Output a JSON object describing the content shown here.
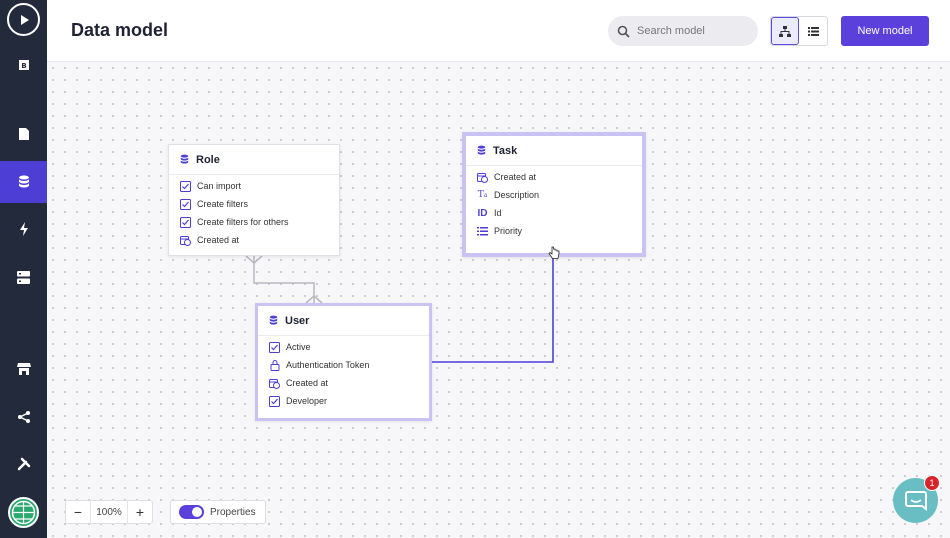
{
  "sidebar": {
    "items": [
      {
        "name": "book-icon"
      },
      {
        "name": "pages-icon"
      },
      {
        "name": "database-icon"
      },
      {
        "name": "lightning-icon"
      },
      {
        "name": "server-icon"
      },
      {
        "name": "store-icon"
      },
      {
        "name": "share-icon"
      },
      {
        "name": "tools-icon"
      }
    ]
  },
  "header": {
    "title": "Data model",
    "search_placeholder": "Search model",
    "new_button": "New model"
  },
  "models": {
    "role": {
      "title": "Role",
      "fields": [
        {
          "label": "Can import",
          "icon": "checkbox-icon"
        },
        {
          "label": "Create filters",
          "icon": "checkbox-icon"
        },
        {
          "label": "Create filters for others",
          "icon": "checkbox-icon"
        },
        {
          "label": "Created at",
          "icon": "calendar-clock-icon"
        }
      ]
    },
    "task": {
      "title": "Task",
      "fields": [
        {
          "label": "Created at",
          "icon": "calendar-clock-icon"
        },
        {
          "label": "Description",
          "icon": "text-icon"
        },
        {
          "label": "Id",
          "icon": "id-icon"
        },
        {
          "label": "Priority",
          "icon": "list-icon"
        }
      ]
    },
    "user": {
      "title": "User",
      "fields": [
        {
          "label": "Active",
          "icon": "checkbox-icon"
        },
        {
          "label": "Authentication Token",
          "icon": "lock-icon"
        },
        {
          "label": "Created at",
          "icon": "calendar-clock-icon"
        },
        {
          "label": "Developer",
          "icon": "checkbox-icon"
        }
      ]
    }
  },
  "controls": {
    "zoom_level": "100%",
    "properties_label": "Properties"
  },
  "chat": {
    "badge_count": "1"
  },
  "colors": {
    "accent": "#5b40dc",
    "sidebar": "#232a3b"
  }
}
